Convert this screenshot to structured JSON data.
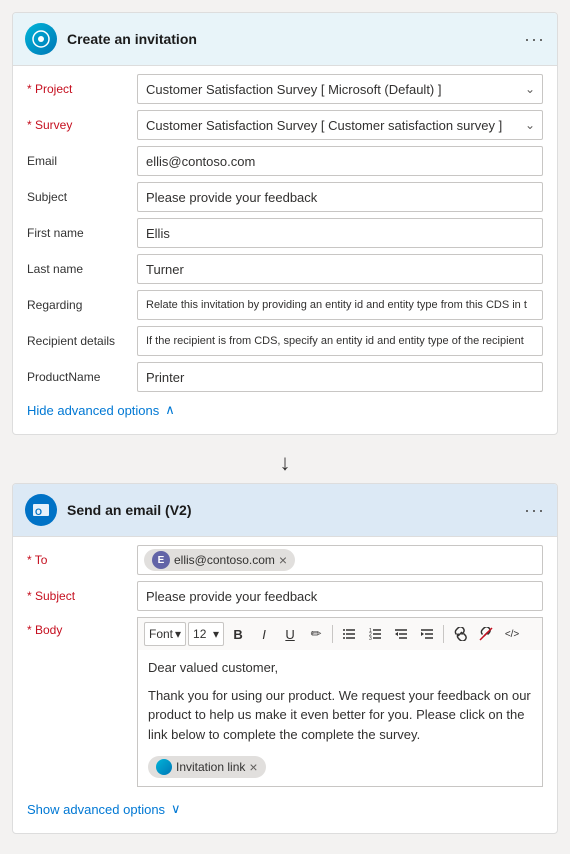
{
  "card1": {
    "title": "Create an invitation",
    "icon_alt": "survey-icon",
    "fields": [
      {
        "label": "* Project",
        "required": true,
        "type": "select",
        "value": "Customer Satisfaction Survey [ Microsoft (Default) ]"
      },
      {
        "label": "* Survey",
        "required": true,
        "type": "select",
        "value": "Customer Satisfaction Survey [ Customer satisfaction survey ]"
      },
      {
        "label": "Email",
        "required": false,
        "type": "input",
        "value": "ellis@contoso.com"
      },
      {
        "label": "Subject",
        "required": false,
        "type": "input",
        "value": "Please provide your feedback"
      },
      {
        "label": "First name",
        "required": false,
        "type": "input",
        "value": "Ellis"
      },
      {
        "label": "Last name",
        "required": false,
        "type": "input",
        "value": "Turner"
      },
      {
        "label": "Regarding",
        "required": false,
        "type": "input",
        "value": "Relate this invitation by providing an entity id and entity type from this CDS in t"
      },
      {
        "label": "Recipient details",
        "required": false,
        "type": "input",
        "value": "If the recipient is from CDS, specify an entity id and entity type of the recipient"
      },
      {
        "label": "ProductName",
        "required": false,
        "type": "input",
        "value": "Printer"
      }
    ],
    "hide_advanced": "Hide advanced options"
  },
  "card2": {
    "title": "Send an email (V2)",
    "icon_alt": "outlook-icon",
    "to_label": "* To",
    "to_tag": "ellis@contoso.com",
    "to_avatar": "E",
    "subject_label": "* Subject",
    "subject_value": "Please provide your feedback",
    "body_label": "* Body",
    "toolbar": {
      "font": "Font",
      "size": "12",
      "bold": "B",
      "italic": "I",
      "underline": "U",
      "pencil": "✏",
      "bullets_unordered": "≡",
      "bullets_ordered": "≡",
      "indent_left": "⇤",
      "indent_right": "⇥",
      "link": "⛓",
      "unlink": "⛓",
      "code": "</>",
      "chevron": "▾"
    },
    "body_line1": "Dear valued customer,",
    "body_line2": "Thank you for using our product. We request your feedback on our product to help us make it even better for you. Please click on the link below to complete the complete the survey.",
    "invitation_tag": "Invitation link",
    "show_advanced": "Show advanced options"
  }
}
